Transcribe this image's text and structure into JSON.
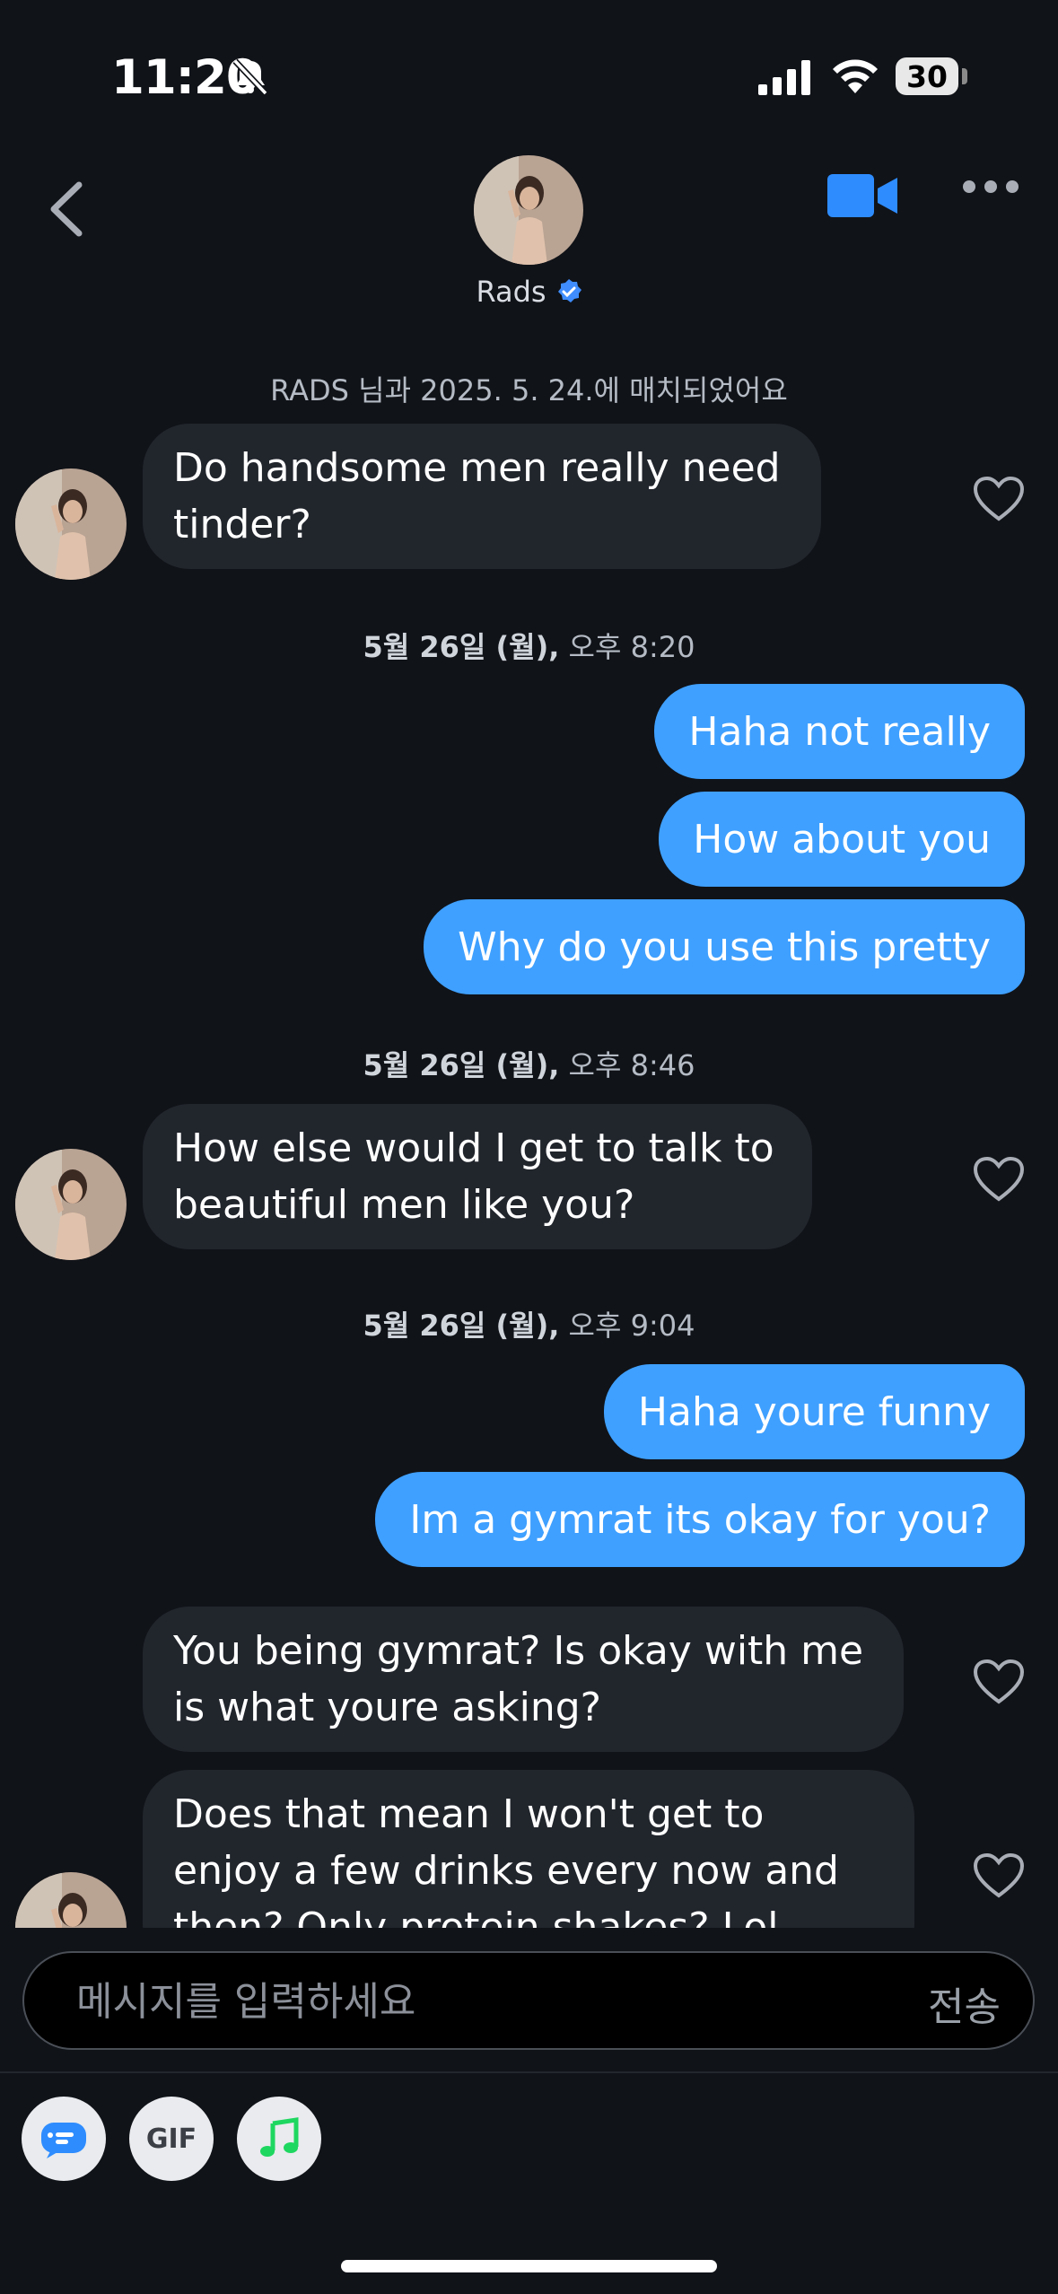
{
  "status_bar": {
    "time": "11:20",
    "battery": "30"
  },
  "header": {
    "name": "Rads"
  },
  "match_note": "RADS 님과 2025. 5. 24.에 매치되었어요",
  "messages": {
    "m1": "Do handsome men really need tinder?",
    "ts1_date": "5월 26일 (월),",
    "ts1_time": " 오후 8:20",
    "m2": "Haha not really",
    "m3": "How about you",
    "m4": "Why do you use this pretty",
    "ts2_date": "5월 26일 (월),",
    "ts2_time": " 오후 8:46",
    "m5": "How else would I get to talk to beautiful men like you?",
    "ts3_date": "5월 26일 (월),",
    "ts3_time": " 오후 9:04",
    "m6": "Haha youre funny",
    "m7": "Im a gymrat its okay for you?",
    "m8": "You being gymrat? Is okay with me is what youre asking?",
    "m9": "Does that mean I won't get to enjoy a few drinks every now and then? Only protein shakes? Lol"
  },
  "composer": {
    "placeholder": "메시지를 입력하세요",
    "send_label": "전송"
  },
  "toolbar": {
    "gif_label": "GIF"
  },
  "colors": {
    "accent": "#3fa0ff",
    "incoming_bubble": "#21252c",
    "background": "#101318",
    "music_icon": "#1ed760"
  },
  "icons": [
    "bell-slash-icon",
    "signal-icon",
    "wifi-icon",
    "battery-icon",
    "back-icon",
    "verified-icon",
    "video-call-icon",
    "more-icon",
    "heart-icon",
    "chat-card-icon",
    "gif-icon",
    "music-note-icon"
  ]
}
